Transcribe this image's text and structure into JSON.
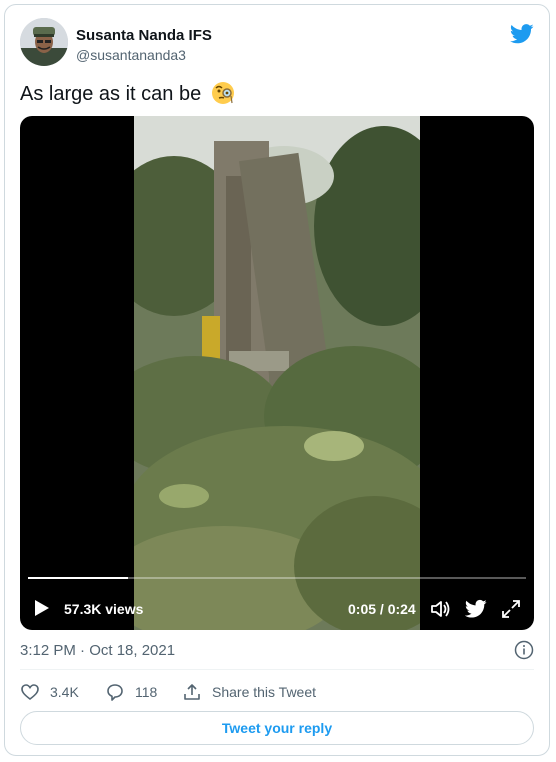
{
  "author": {
    "name": "Susanta Nanda IFS",
    "handle": "@susantananda3"
  },
  "tweet": {
    "text": "As large as it can be",
    "emoji_icon": "face-with-monocle-icon"
  },
  "video": {
    "views": "57.3K views",
    "time": "0:05 / 0:24",
    "progress": 0.2,
    "icons": [
      "play-icon",
      "volume-icon",
      "twitter-bird-icon",
      "fullscreen-icon"
    ]
  },
  "meta": {
    "timestamp": "3:12 PM · Oct 18, 2021"
  },
  "actions": {
    "likes": "3.4K",
    "replies": "118",
    "share_label": "Share this Tweet"
  },
  "reply_button": "Tweet your reply",
  "colors": {
    "accent": "#1d9bf0",
    "text": "#0f1419",
    "secondary": "#536471",
    "border": "#cfd9de"
  }
}
